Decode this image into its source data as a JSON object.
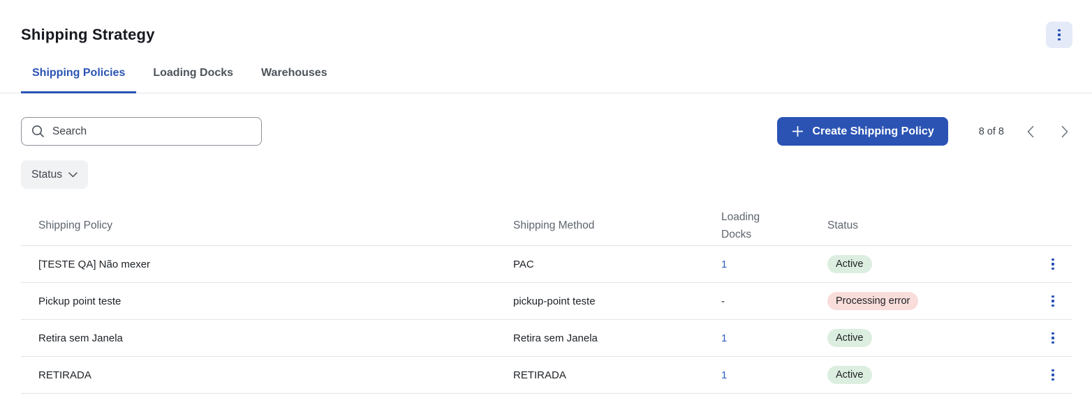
{
  "colors": {
    "accent_blue": "#2a53b3",
    "header_menu_bg": "#e4eaf8",
    "tab_inactive": "#4c545c",
    "divider": "#e2e4e8",
    "table_header_text": "#5d646e",
    "row_text": "#1d2126",
    "link_blue": "#2e5cc5",
    "badge_active_bg": "#dceee0",
    "badge_error_bg": "#f9dddb",
    "badge_text": "#1d2023",
    "filter_bg": "#f1f2f4"
  },
  "icons": {
    "header_menu": "kebab-vertical-dots",
    "search": "magnifier",
    "create": "plus",
    "status_filter": "chevron-down",
    "prev_page": "chevron-left",
    "next_page": "chevron-right",
    "row_menu": "kebab-vertical-dots"
  },
  "header": {
    "title": "Shipping Strategy"
  },
  "tabs": {
    "items": [
      {
        "label": "Shipping Policies",
        "active": true
      },
      {
        "label": "Loading Docks",
        "active": false
      },
      {
        "label": "Warehouses",
        "active": false
      }
    ]
  },
  "toolbar": {
    "search_placeholder": "Search",
    "search_value": "",
    "create_button_label": "Create Shipping Policy",
    "pagination_text": "8 of 8"
  },
  "filters": {
    "status_label": "Status"
  },
  "table": {
    "columns": [
      "Shipping Policy",
      "Shipping Method",
      "Loading Docks",
      "Status"
    ],
    "rows": [
      {
        "policy": "[TESTE QA] Não mexer",
        "method": "PAC",
        "loading_docks": "1",
        "docks_link": true,
        "status": "Active",
        "status_type": "active"
      },
      {
        "policy": "Pickup point teste",
        "method": "pickup-point teste",
        "loading_docks": "-",
        "docks_link": false,
        "status": "Processing error",
        "status_type": "error"
      },
      {
        "policy": "Retira sem Janela",
        "method": "Retira sem Janela",
        "loading_docks": "1",
        "docks_link": true,
        "status": "Active",
        "status_type": "active"
      },
      {
        "policy": "RETIRADA",
        "method": "RETIRADA",
        "loading_docks": "1",
        "docks_link": true,
        "status": "Active",
        "status_type": "active"
      }
    ]
  }
}
